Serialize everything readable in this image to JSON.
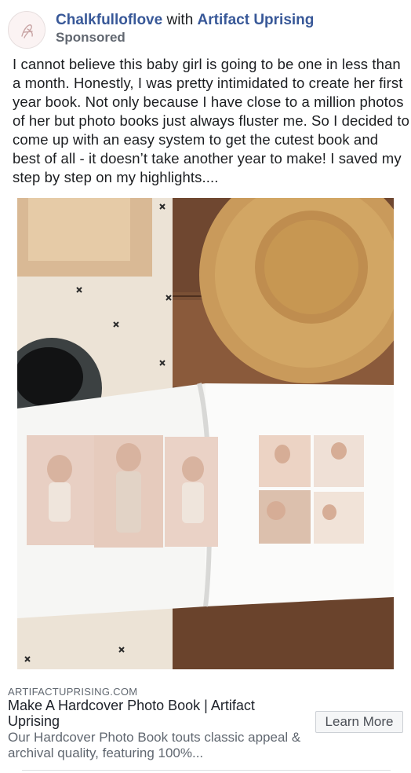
{
  "post": {
    "page_name": "Chalkfulloflove",
    "with_text": "with",
    "partner_name": "Artifact Uprising",
    "sponsored_label": "Sponsored",
    "avatar_icon": "script-logo-icon",
    "body_text": "I cannot believe this baby girl is going to be one in less than a month. Honestly, I was pretty intimidated to create her first year book. Not only because I have close to a million photos of her but photo books just always fluster me. So I decided to come up with an easy system to get the cutest book and best of all - it doesn’t take another year to make! I saved my step by step on my highlights...."
  },
  "link": {
    "domain": "ARTIFACTUPRISING.COM",
    "title": "Make A Hardcover Photo Book | Artifact Uprising",
    "description": "Our Hardcover Photo Book touts classic appeal & archival quality, featuring 100%...",
    "cta_label": "Learn More"
  },
  "colors": {
    "link_blue": "#385898",
    "meta_gray": "#616770",
    "wood": "#7a5035",
    "straw": "#c99a5b"
  }
}
